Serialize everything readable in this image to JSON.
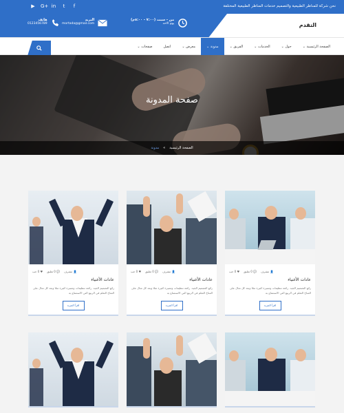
{
  "colors": {
    "primary": "#2f6fc8",
    "bg": "#f3f3f3"
  },
  "topbar": {
    "social_icons": [
      "youtube-icon",
      "google-plus-icon",
      "linkedin-icon",
      "twitter-icon",
      "facebook-icon"
    ],
    "social_glyphs": [
      "▶",
      "G+",
      "in",
      "t",
      "f"
    ],
    "tagline": "نحن شركة للمناظر الطبيعية والتصميم خدمات المناظر الطبيعية المختلفة"
  },
  "header": {
    "logo": "التقدم",
    "hours_title": "من - سبت (٧:٠٠ - ٥:٠٠م)",
    "hours_sub": "يوم الاحد",
    "email_title": "البريد",
    "email_value": "mortada@gmail.com",
    "phone_title": "هاتف",
    "phone_value": "0123456789"
  },
  "nav": {
    "items": [
      "الصفحة الرئيسية",
      "حول",
      "الخدمات",
      "الفريق",
      "مدونة",
      "معرض",
      "اتصل",
      "صفحات"
    ],
    "active_index": 4
  },
  "hero": {
    "title": "صفحة المدونة",
    "breadcrumb_home": "الصفحة الرئيسية",
    "breadcrumb_current": "مدونة"
  },
  "cards": [
    {
      "author": "مشرف",
      "comments": "0 تعليق",
      "likes": "0 حب",
      "title": "عادات الأغنياء",
      "excerpt": "رائع التصميم الجيد. رائعة تنظيمات ومميزة كثيرة مثلا وبعد كل مثال على المناخ التعلم في الربيع التي الاستمتاع به",
      "button": "اقرأ المزيد",
      "scene": "sc3"
    },
    {
      "author": "مشرف",
      "comments": "0 تعليق",
      "likes": "0 حب",
      "title": "عادات الأغنياء",
      "excerpt": "رائع التصميم الجيد. رائعة تنظيمات ومميزة كثيرة مثلا وبعد كل مثال على المناخ التعلم في الربيع التي الاستمتاع به",
      "button": "اقرأ المزيد",
      "scene": "sc2"
    },
    {
      "author": "مشرف",
      "comments": "0 تعليق",
      "likes": "0 حب",
      "title": "عادات الأغنياء",
      "excerpt": "رائع التصميم الجيد. رائعة تنظيمات ومميزة كثيرة مثلا وبعد كل مثال على المناخ التعلم في الربيع التي الاستمتاع به",
      "button": "اقرأ المزيد",
      "scene": "sc1"
    }
  ]
}
